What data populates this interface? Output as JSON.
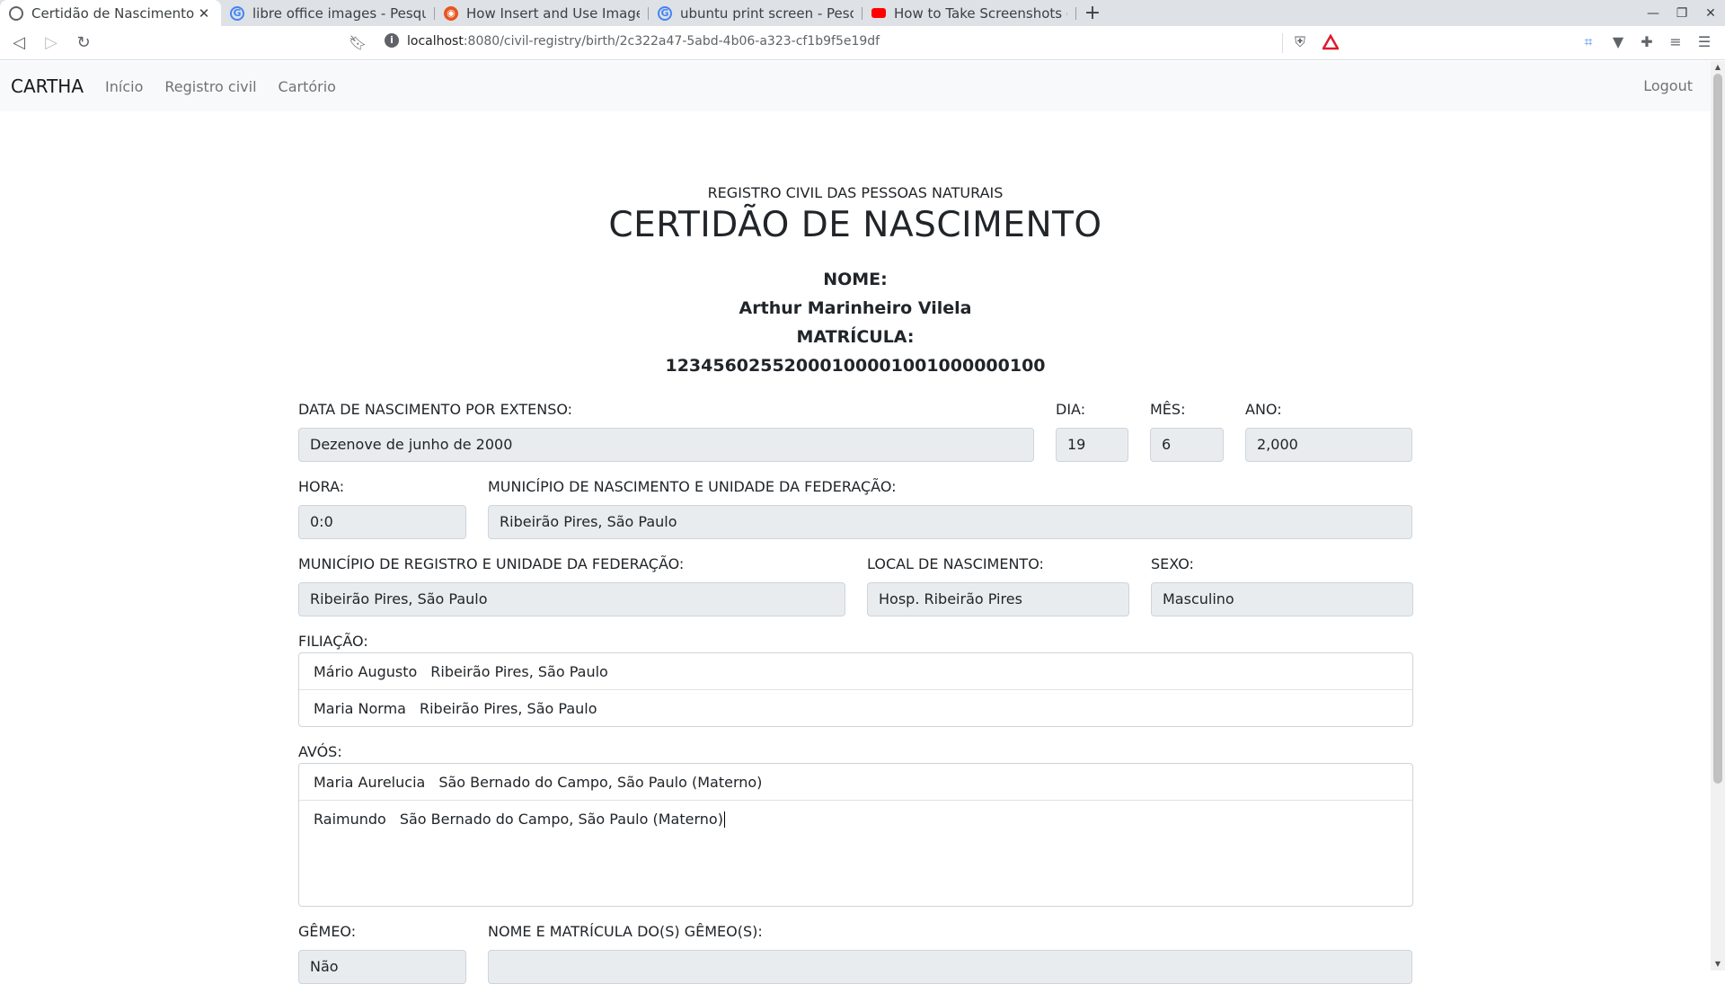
{
  "browser": {
    "tabs": [
      {
        "title": "Certidão de Nascimento",
        "icon": "globe-icon",
        "active": true
      },
      {
        "title": "libre office images - Pesquisa",
        "icon": "google-icon"
      },
      {
        "title": "How Insert and Use Images in",
        "icon": "ubuntu-icon"
      },
      {
        "title": "ubuntu print screen - Pesquis",
        "icon": "google-icon"
      },
      {
        "title": "How to Take Screenshots on U",
        "icon": "youtube-icon"
      }
    ],
    "url_host": "localhost",
    "url_path": ":8080/civil-registry/birth/2c322a47-5abd-4b06-a323-cf1b9f5e19df"
  },
  "nav": {
    "brand": "CARTHA",
    "links": [
      "Início",
      "Registro civil",
      "Cartório"
    ],
    "logout": "Logout"
  },
  "certificate": {
    "registry": "REGISTRO CIVIL DAS PESSOAS NATURAIS",
    "title": "CERTIDÃO DE NASCIMENTO",
    "nome_label": "NOME:",
    "nome": "Arthur Marinheiro Vilela",
    "matricula_label": "MATRÍCULA:",
    "matricula": "123456025520001000010010000001​00"
  },
  "fields": {
    "data_extenso": {
      "label": "DATA DE NASCIMENTO POR EXTENSO:",
      "value": "Dezenove de junho de 2000"
    },
    "dia": {
      "label": "DIA:",
      "value": "19"
    },
    "mes": {
      "label": "MÊS:",
      "value": "6"
    },
    "ano": {
      "label": "ANO:",
      "value": "2,000"
    },
    "hora": {
      "label": "HORA:",
      "value": "0:0"
    },
    "municipio_nasc": {
      "label": "MUNICÍPIO DE NASCIMENTO E UNIDADE DA FEDERAÇÃO:",
      "value": "Ribeirão Pires, São Paulo"
    },
    "municipio_reg": {
      "label": "MUNICÍPIO DE REGISTRO E UNIDADE DA FEDERAÇÃO:",
      "value": "Ribeirão Pires, São Paulo"
    },
    "local_nasc": {
      "label": "LOCAL DE NASCIMENTO:",
      "value": "Hosp. Ribeirão Pires"
    },
    "sexo": {
      "label": "SEXO:",
      "value": "Masculino"
    },
    "filiacao": {
      "label": "FILIAÇÃO:",
      "items": [
        {
          "name": "Mário Augusto",
          "place": "Ribeirão Pires, São Paulo"
        },
        {
          "name": "Maria Norma",
          "place": "Ribeirão Pires, São Paulo"
        }
      ]
    },
    "avos": {
      "label": "AVÓS:",
      "items": [
        {
          "name": "Maria Aurelucia",
          "place": "São Bernado do Campo, São Paulo (Materno)"
        },
        {
          "name": "Raimundo",
          "place": "São Bernado do Campo, São Paulo (Materno)"
        }
      ]
    },
    "gemeo": {
      "label": "GÊMEO:",
      "value": "Não"
    },
    "gemeos_nome": {
      "label": "NOME E MATRÍCULA DO(S) GÊMEO(S):",
      "value": ""
    }
  }
}
